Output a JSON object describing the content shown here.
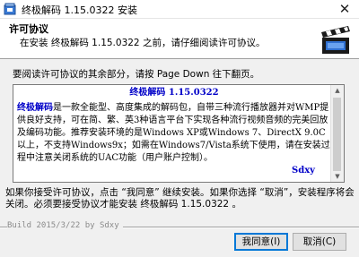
{
  "window": {
    "title": "终极解码 1.15.0322 安装",
    "close_glyph": "✕"
  },
  "header": {
    "title": "许可协议",
    "subtitle": "在安装 终极解码 1.15.0322 之前，请仔细阅读许可协议。",
    "logo_icon": "film-clapper-icon"
  },
  "prompt": "要阅读许可协议的其余部分，请按 Page Down 往下翻页。",
  "license": {
    "title": "终极解码 1.15.0322",
    "brand": "终极解码",
    "paragraph_rest": "是一款全能型、高度集成的解码包，自带三种流行播放器并对WMP提供良好支持，可在简、繁、英3种语言平台下实现各种流行视频音频的完美回放及编码功能。推荐安装环境的是Windows XP或Windows 7、DirectX 9.0C以上，不支持Windows9x；如需在Windows7/Vista系统下使用，请在安装过程中注意关闭系统的UAC功能（用户账户控制）。",
    "signature": "Sdxy"
  },
  "footer": {
    "text": "如果你接受许可协议，点击 “我同意” 继续安装。如果你选择 “取消”，安装程序将会关闭。必须要接受协议才能安装 终极解码 1.15.0322 。"
  },
  "branding": "Build 2015/3/22 by Sdxy",
  "buttons": {
    "agree": "我同意(I)",
    "cancel": "取消(C)"
  },
  "colors": {
    "accent": "#0000c8",
    "focus_border": "#0078d7"
  }
}
